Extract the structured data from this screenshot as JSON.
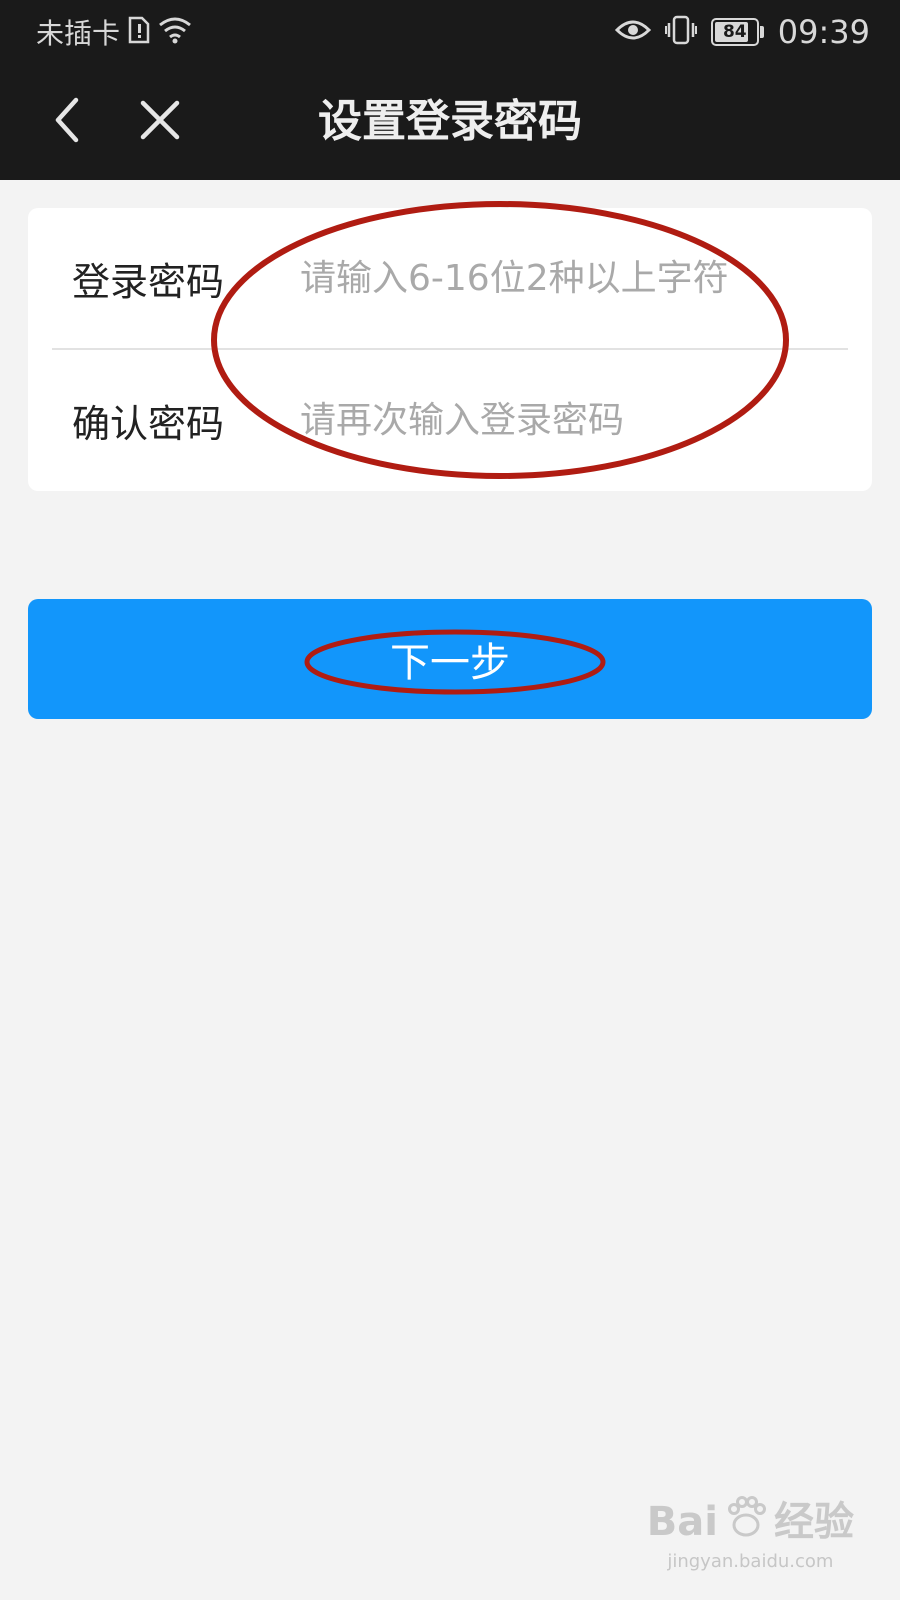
{
  "status_bar": {
    "carrier": "未插卡",
    "battery": "84",
    "battery_level": 0.84,
    "time": "09:39"
  },
  "nav": {
    "title": "设置登录密码",
    "back_icon": "chevron-left-icon",
    "close_icon": "close-icon"
  },
  "form": {
    "password_label": "登录密码",
    "password_placeholder": "请输入6-16位2种以上字符",
    "password_value": "",
    "confirm_label": "确认密码",
    "confirm_placeholder": "请再次输入登录密码",
    "confirm_value": ""
  },
  "next_button": {
    "label": "下一步"
  },
  "watermark": {
    "logo_left": "Bai",
    "logo_right": "经验",
    "url": "jingyan.baidu.com"
  },
  "colors": {
    "topbar": "#1a1a1a",
    "background": "#f3f3f3",
    "accent": "#1296fb",
    "annotation": "#b01c12"
  }
}
